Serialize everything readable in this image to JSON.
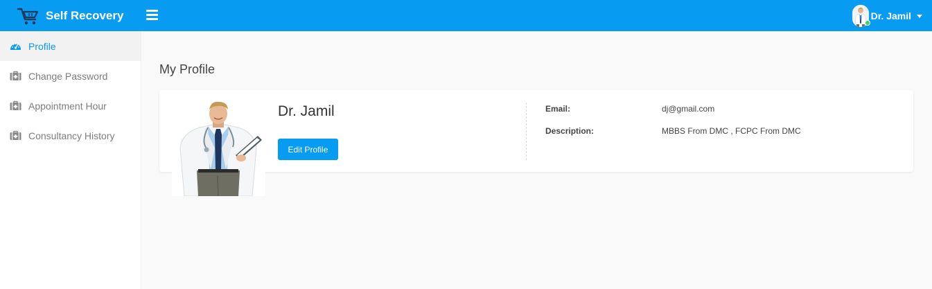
{
  "header": {
    "brand": "Self Recovery",
    "user_name": "Dr. Jamil",
    "accent_color": "#079bf1"
  },
  "sidebar": {
    "items": [
      {
        "label": "Profile",
        "icon": "dashboard-icon",
        "active": true
      },
      {
        "label": "Change Password",
        "icon": "medkit-icon",
        "active": false
      },
      {
        "label": "Appointment Hour",
        "icon": "medkit-icon",
        "active": false
      },
      {
        "label": "Consultancy History",
        "icon": "medkit-icon",
        "active": false
      }
    ]
  },
  "main": {
    "page_title": "My Profile",
    "profile": {
      "name": "Dr. Jamil",
      "edit_label": "Edit Profile",
      "email_label": "Email:",
      "email_value": "dj@gmail.com",
      "description_label": "Description:",
      "description_value": "MBBS From DMC , FCPC From DMC"
    }
  }
}
